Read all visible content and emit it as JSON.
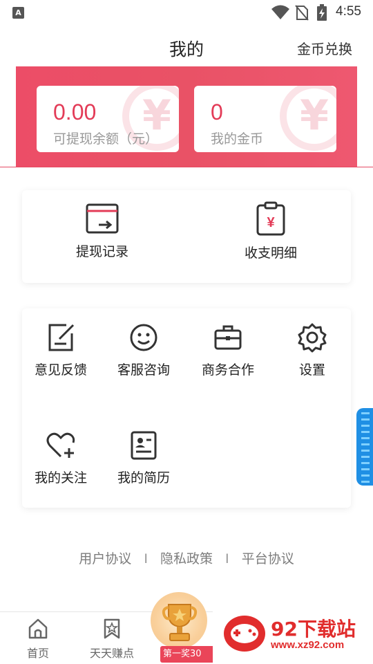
{
  "status_bar": {
    "time": "4:55",
    "app_icon_letter": "A"
  },
  "header": {
    "title": "我的",
    "exchange_label": "金币兑换"
  },
  "wallet": {
    "balance_value": "0.00",
    "balance_label": "可提现余额（元）",
    "coins_value": "0",
    "coins_label": "我的金币",
    "watermark_glyph": "¥"
  },
  "records": [
    {
      "label": "提现记录",
      "icon": "withdraw-record-icon"
    },
    {
      "label": "收支明细",
      "icon": "income-expense-icon"
    }
  ],
  "services": [
    {
      "label": "意见反馈",
      "icon": "feedback-icon"
    },
    {
      "label": "客服咨询",
      "icon": "customer-service-icon"
    },
    {
      "label": "商务合作",
      "icon": "briefcase-icon"
    },
    {
      "label": "设置",
      "icon": "gear-icon"
    },
    {
      "label": "我的关注",
      "icon": "heart-plus-icon"
    },
    {
      "label": "我的简历",
      "icon": "resume-icon"
    }
  ],
  "footer_links": {
    "user_agreement": "用户协议",
    "privacy_policy": "隐私政策",
    "platform_agreement": "平台协议",
    "separator": "I"
  },
  "tabbar": [
    {
      "label": "首页",
      "icon": "home-icon"
    },
    {
      "label": "天天赚点",
      "icon": "bookmark-star-icon"
    }
  ],
  "promo": {
    "badge_text": "第一奖30"
  },
  "site_watermark": {
    "name": "92下载站",
    "url": "www.xz92.com"
  },
  "colors": {
    "accent": "#e33b57",
    "banner": "#ec4d67",
    "side_tab": "#1f8fe4"
  }
}
